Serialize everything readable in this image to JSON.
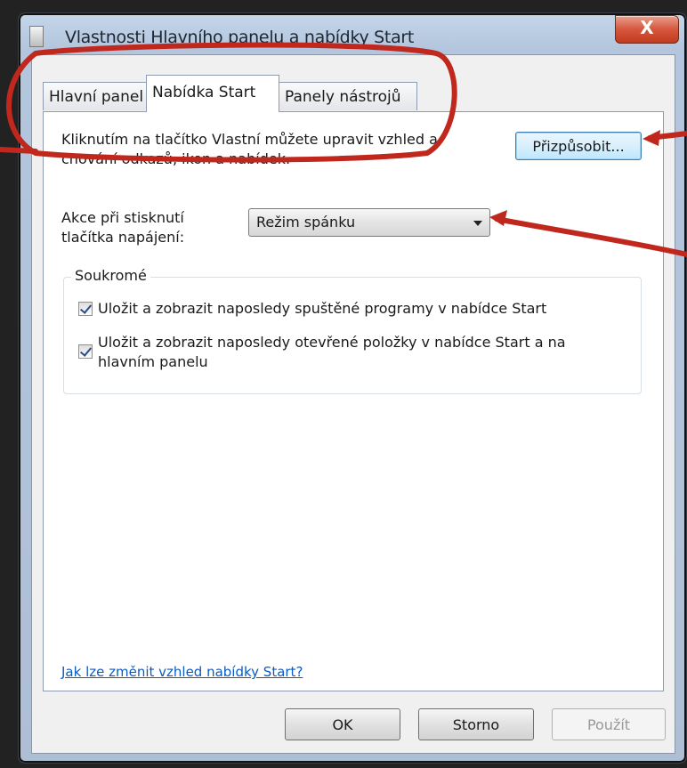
{
  "window": {
    "title": "Vlastnosti Hlavního panelu a nabídky Start",
    "close_label": "X"
  },
  "tabs": [
    {
      "label": "Hlavní panel",
      "active": false
    },
    {
      "label": "Nabídka Start",
      "active": true
    },
    {
      "label": "Panely nástrojů",
      "active": false
    }
  ],
  "start_menu": {
    "description": "Kliknutím na tlačítko Vlastní můžete upravit vzhled a chování odkazů, ikon a nabídek.",
    "customize_label": "Přizpůsobit...",
    "power_label": "Akce při stisknutí tlačítka napájení:",
    "power_value": "Režim spánku"
  },
  "privacy": {
    "title": "Soukromé",
    "items": [
      {
        "label": "Uložit a zobrazit naposledy spuštěné programy v nabídce Start",
        "checked": true
      },
      {
        "label": "Uložit a zobrazit naposledy otevřené položky v nabídce Start a na hlavním panelu",
        "checked": true
      }
    ]
  },
  "help_link": "Jak lze změnit vzhled nabídky Start?",
  "buttons": {
    "ok": "OK",
    "cancel": "Storno",
    "apply": "Použít"
  },
  "colors": {
    "annotation": "#c0281d",
    "link": "#0a5bc4"
  }
}
